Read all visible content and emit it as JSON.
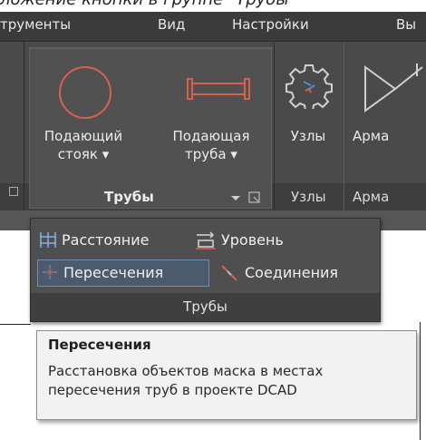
{
  "caption": "ложение кнопки в группе \"Трубы\"",
  "menu": [
    "трументы",
    "Вид",
    "Настройки",
    "Вы"
  ],
  "ribbon": {
    "buttons": [
      {
        "line1": "Подающий",
        "line2": "стояк ▾"
      },
      {
        "line1": "Подающая",
        "line2": "труба ▾"
      },
      {
        "line1": "Узлы",
        "line2": ""
      },
      {
        "line1": "Арма",
        "line2": ""
      }
    ],
    "footers": [
      "Трубы",
      "Узлы",
      "Арма"
    ]
  },
  "dropdown": {
    "items": [
      "Расстояние",
      "Уровень",
      "Пересечения",
      "Соединения"
    ],
    "footer": "Трубы"
  },
  "tooltip": {
    "title": "Пересечения",
    "line1": "Расстановка объектов маска в местах",
    "line2": "пересечения труб в проекте DCAD"
  },
  "colors": {
    "ribbon_bg": "#4a4a4a",
    "accent_red": "#d9604b",
    "highlight_border": "#6d8fb8",
    "tooltip_bg": "#f2f2f2"
  }
}
